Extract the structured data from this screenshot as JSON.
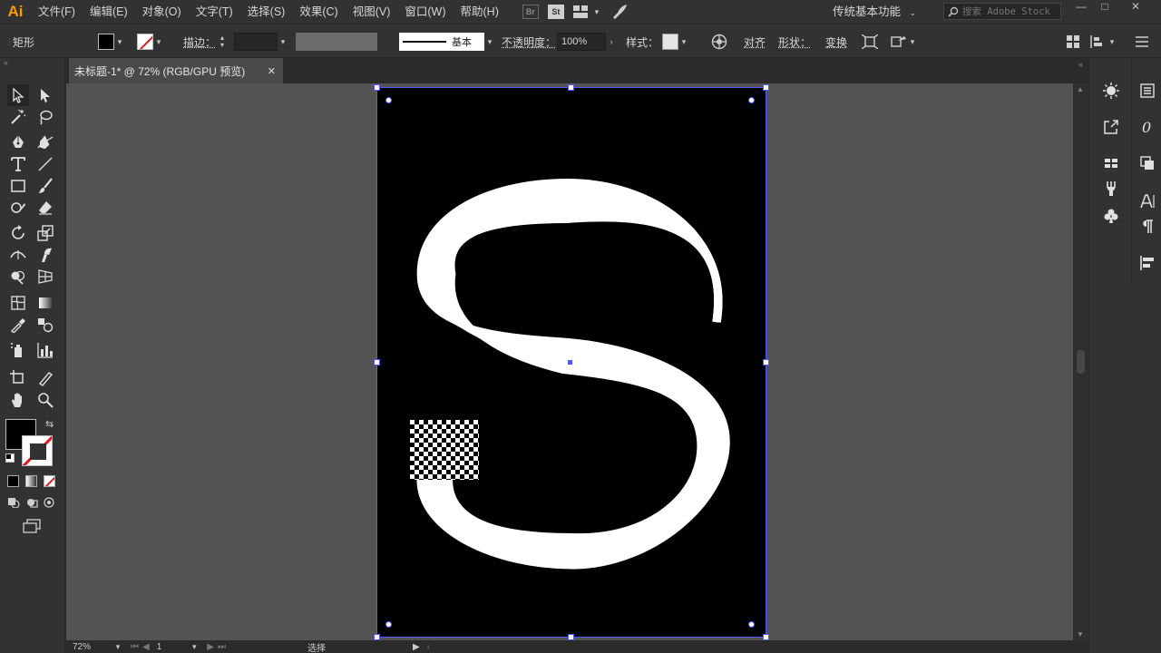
{
  "app": {
    "logo": "Ai",
    "accent": "#ff9a00"
  },
  "menu": [
    "文件(F)",
    "编辑(E)",
    "对象(O)",
    "文字(T)",
    "选择(S)",
    "效果(C)",
    "视图(V)",
    "窗口(W)",
    "帮助(H)"
  ],
  "menubar_icons": {
    "br": "Br",
    "st": "St"
  },
  "workspace": {
    "label": "传统基本功能"
  },
  "search": {
    "placeholder": "搜索 Adobe Stock"
  },
  "control": {
    "object_type": "矩形",
    "stroke_label": "描边：",
    "stroke_style": "基本",
    "opacity_label": "不透明度：",
    "opacity_value": "100%",
    "style_label": "样式：",
    "align_label": "对齐",
    "shape_label": "形状：",
    "transform_label": "变换"
  },
  "document": {
    "tab_title": "未标题-1* @ 72% (RGB/GPU 预览)",
    "close": "✕"
  },
  "status": {
    "zoom": "72%",
    "artboard_num": "1",
    "tool_name": "选择"
  },
  "colors": {
    "selection": "#4b5cff",
    "artboard": "#000000",
    "canvas": "#535353"
  }
}
